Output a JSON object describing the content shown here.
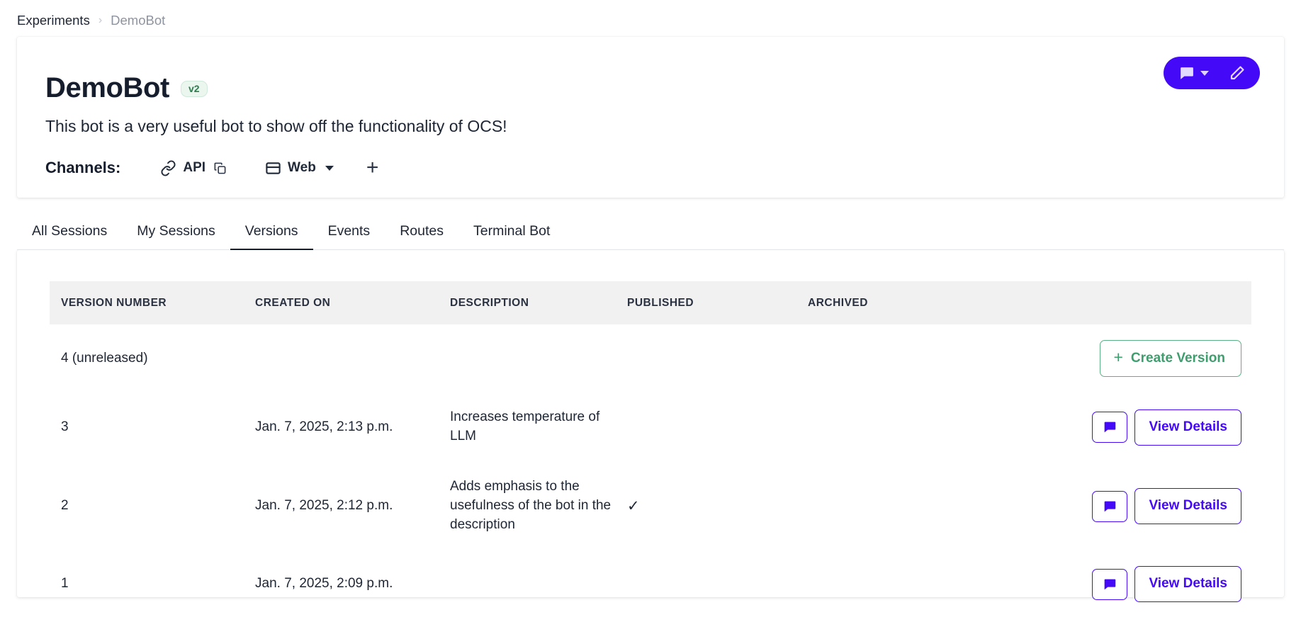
{
  "breadcrumb": {
    "root": "Experiments",
    "separator": "›",
    "current": "DemoBot"
  },
  "header": {
    "title": "DemoBot",
    "version_badge": "v2",
    "description": "This bot is a very useful bot to show off the functionality of OCS!",
    "channels_label": "Channels:",
    "channels": [
      {
        "label": "API",
        "icon": "link-icon",
        "has_copy": true,
        "has_caret": false
      },
      {
        "label": "Web",
        "icon": "browser-window-icon",
        "has_copy": false,
        "has_caret": true
      }
    ],
    "add_channel_glyph": "+",
    "actions": {
      "chat_icon": "chat-bubble-icon",
      "chat_caret": "chevron-down-icon",
      "edit_icon": "pencil-icon"
    }
  },
  "tabs": [
    {
      "label": "All Sessions",
      "active": false
    },
    {
      "label": "My Sessions",
      "active": false
    },
    {
      "label": "Versions",
      "active": true
    },
    {
      "label": "Events",
      "active": false
    },
    {
      "label": "Routes",
      "active": false
    },
    {
      "label": "Terminal Bot",
      "active": false
    }
  ],
  "table": {
    "columns": [
      "VERSION NUMBER",
      "CREATED ON",
      "DESCRIPTION",
      "PUBLISHED",
      "ARCHIVED"
    ],
    "rows": [
      {
        "version": "4 (unreleased)",
        "created_on": "",
        "description": "",
        "published": "",
        "archived": "",
        "actions": {
          "type": "create",
          "create_label": "Create Version",
          "plus": "+"
        }
      },
      {
        "version": "3",
        "created_on": "Jan. 7, 2025, 2:13 p.m.",
        "description": "Increases temperature of LLM",
        "published": "",
        "archived": "",
        "actions": {
          "type": "details",
          "details_label": "View Details"
        }
      },
      {
        "version": "2",
        "created_on": "Jan. 7, 2025, 2:12 p.m.",
        "description": "Adds emphasis to the usefulness of the bot in the description",
        "published": "✓",
        "archived": "",
        "actions": {
          "type": "details",
          "details_label": "View Details"
        }
      },
      {
        "version": "1",
        "created_on": "Jan. 7, 2025, 2:09 p.m.",
        "description": "",
        "published": "",
        "archived": "",
        "actions": {
          "type": "details",
          "details_label": "View Details"
        }
      }
    ]
  },
  "colors": {
    "accent_purple": "#4409f7",
    "green": "#3f9e6e",
    "badge_green_bg": "#eaf6ee",
    "header_row_bg": "#f1f1f1",
    "text_dark": "#1e2533",
    "text_muted": "#8e949f"
  }
}
